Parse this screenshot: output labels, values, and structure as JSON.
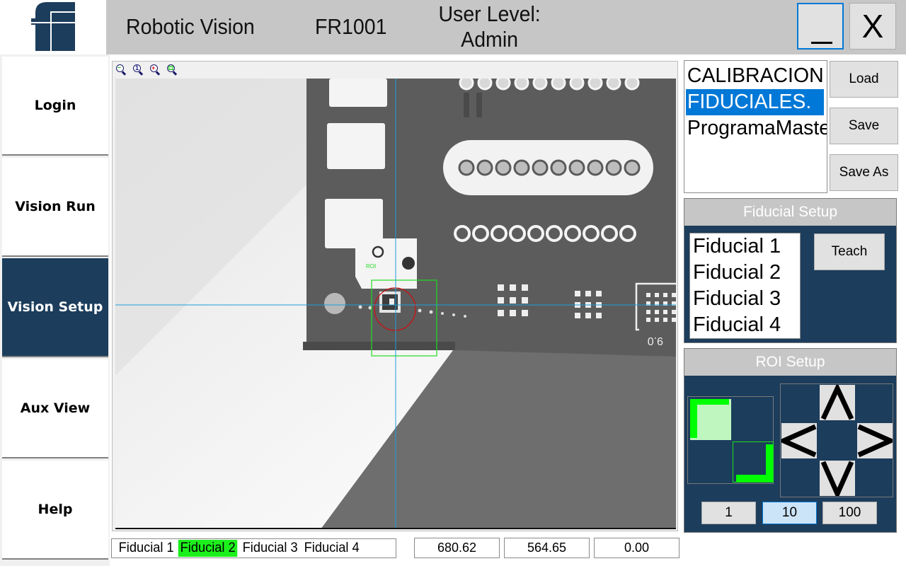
{
  "header": {
    "app_title": "Robotic Vision",
    "machine_id": "FR1001",
    "user_level_label": "User Level:",
    "user_level_value": "Admin",
    "minimize_label": "_",
    "close_label": "X",
    "logo_icon": "company-logo-ff"
  },
  "sidebar": {
    "items": [
      {
        "label": "Login",
        "active": false
      },
      {
        "label": "Vision Run",
        "active": false
      },
      {
        "label": "Vision Setup",
        "active": true
      },
      {
        "label": "Aux View",
        "active": false
      },
      {
        "label": "Help",
        "active": false
      }
    ]
  },
  "viewer": {
    "toolbar": [
      {
        "icon": "zoom-out-icon"
      },
      {
        "icon": "zoom-1to1-icon"
      },
      {
        "icon": "zoom-in-icon"
      },
      {
        "icon": "zoom-fit-icon"
      }
    ],
    "roi_label": "ROI",
    "board_marking": "9.0",
    "crosshair_color": "#1e9fd8",
    "roi_color": "#22dd22",
    "fiducial_marker_color": "#cc1010"
  },
  "status_bar": {
    "fiducial_tabs": [
      {
        "label": "Fiducial 1",
        "active": false
      },
      {
        "label": "Fiducial 2",
        "active": true
      },
      {
        "label": "Fiducial 3",
        "active": false
      },
      {
        "label": "Fiducial 4",
        "active": false
      }
    ],
    "x_value": "680.62",
    "y_value": "564.65",
    "angle_value": "0.00"
  },
  "programs": {
    "items": [
      {
        "label": "CALIBRACION",
        "selected": false
      },
      {
        "label": "FIDUCIALES.",
        "selected": true
      },
      {
        "label": "ProgramaMaster",
        "selected": false
      }
    ],
    "load_label": "Load",
    "save_label": "Save",
    "save_as_label": "Save As"
  },
  "fiducial_setup": {
    "title": "Fiducial Setup",
    "items": [
      "Fiducial 1",
      "Fiducial 2",
      "Fiducial 3",
      "Fiducial 4"
    ],
    "teach_label": "Teach"
  },
  "roi_setup": {
    "title": "ROI Setup",
    "size_pad_icon": "roi-corner-resize-icon",
    "arrows": {
      "up": "arrow-up",
      "down": "arrow-down",
      "left": "arrow-left",
      "right": "arrow-right"
    },
    "step_options": [
      {
        "label": "1",
        "selected": false
      },
      {
        "label": "10",
        "selected": true
      },
      {
        "label": "100",
        "selected": false
      }
    ]
  },
  "colors": {
    "nav_active": "#1c3d5c",
    "panel_bg": "#1c3d5c",
    "selection_blue": "#0078d7",
    "active_fiducial_green": "#1cf01c",
    "header_gray": "#c6c6c6"
  }
}
